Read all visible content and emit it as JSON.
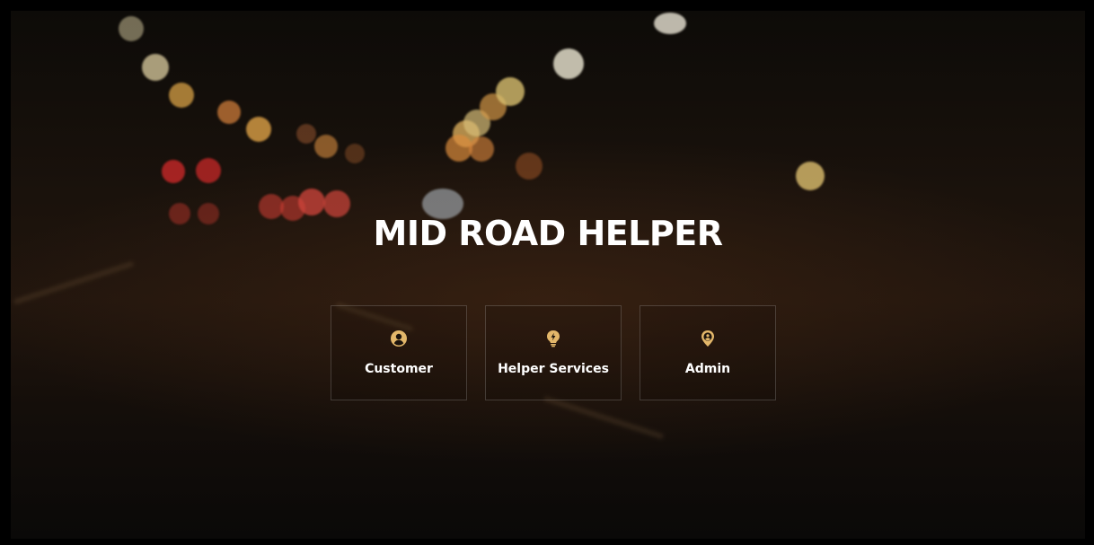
{
  "hero": {
    "title": "MID ROAD HELPER"
  },
  "accent_color": "#e3b76a",
  "cards": [
    {
      "label": "Customer",
      "icon": "user-circle-icon"
    },
    {
      "label": "Helper Services",
      "icon": "lightbulb-icon"
    },
    {
      "label": "Admin",
      "icon": "map-pin-user-icon"
    }
  ]
}
